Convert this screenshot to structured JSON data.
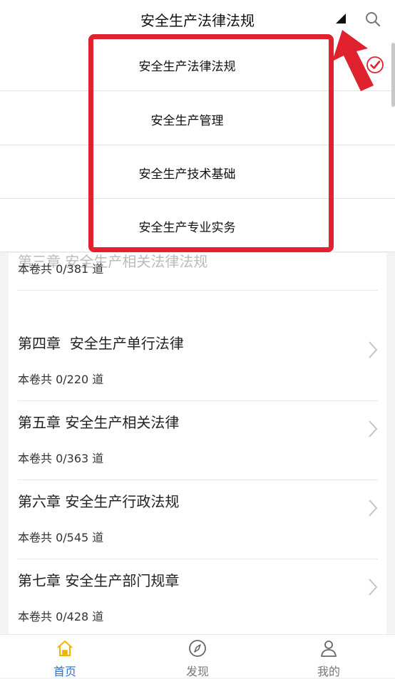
{
  "header": {
    "title": "安全生产法律法规",
    "dropdown_icon": "triangle-down-icon",
    "search_icon": "search-icon"
  },
  "dropdown": {
    "items": [
      {
        "label": "安全生产法律法规",
        "selected": true
      },
      {
        "label": "安全生产管理",
        "selected": false
      },
      {
        "label": "安全生产技术基础",
        "selected": false
      },
      {
        "label": "安全生产专业实务",
        "selected": false
      }
    ]
  },
  "chapters": [
    {
      "title": "第三章 安全生产相关法律法规",
      "count": "本卷共 0/381 道"
    },
    {
      "title": "第四章  安全生产单行法律",
      "count": "本卷共 0/220 道"
    },
    {
      "title": "第五章 安全生产相关法律",
      "count": "本卷共 0/363 道"
    },
    {
      "title": "第六章 安全生产行政法规",
      "count": "本卷共 0/545 道"
    },
    {
      "title": "第七章 安全生产部门规章",
      "count": "本卷共 0/428 道"
    }
  ],
  "bottom_nav": [
    {
      "label": "首页",
      "icon": "home-icon",
      "active": true
    },
    {
      "label": "发现",
      "icon": "compass-icon",
      "active": false
    },
    {
      "label": "我的",
      "icon": "user-icon",
      "active": false
    }
  ],
  "colors": {
    "accent": "#2f6fd8",
    "highlight": "#e0212e",
    "home_icon": "#f2b400"
  }
}
